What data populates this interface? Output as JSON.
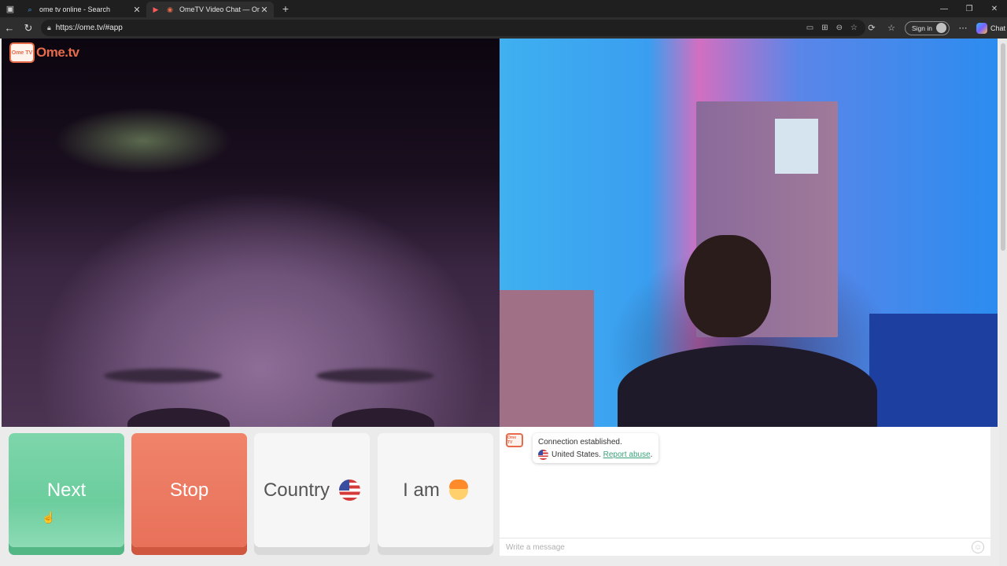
{
  "browser": {
    "tabs": [
      {
        "title": "ome tv online - Search",
        "active": false
      },
      {
        "title": "OmeTV Video Chat — Omeg",
        "active": true
      }
    ],
    "url": "https://ome.tv/#app",
    "signin_label": "Sign in",
    "copilot_label": "Chat"
  },
  "app": {
    "logo_text": "Ome.tv",
    "logo_badge": "Ome TV",
    "buttons": {
      "next": "Next",
      "stop": "Stop",
      "country": "Country",
      "iam": "I am"
    },
    "chat": {
      "system_line1": "Connection established.",
      "country": "United States.",
      "report_link": "Report abuse",
      "report_suffix": ".",
      "input_placeholder": "Write a message"
    }
  },
  "colors": {
    "next": "#6ccd9d",
    "stop": "#e8715a",
    "brand": "#e56b4a",
    "link": "#3aa37a"
  }
}
